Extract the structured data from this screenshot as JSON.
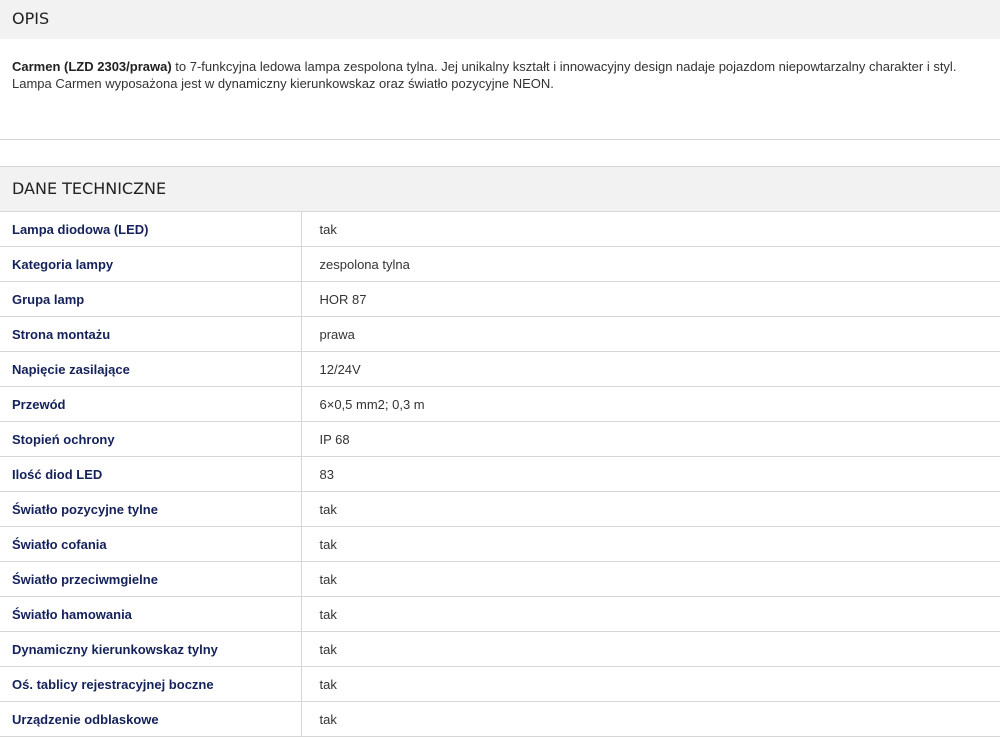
{
  "opis": {
    "title": "OPIS",
    "lead_bold": "Carmen (LZD 2303/prawa)",
    "text": " to 7-funkcyjna ledowa lampa zespolona tylna. Jej unikalny kształt i innowacyjny design nadaje pojazdom niepowtarzalny charakter i styl. Lampa Carmen wyposażona jest w dynamiczny kierunkowskaz oraz światło pozycyjne NEON."
  },
  "tech": {
    "title": "DANE TECHNICZNE",
    "rows": [
      {
        "label": "Lampa diodowa (LED)",
        "value": "tak"
      },
      {
        "label": "Kategoria lampy",
        "value": "zespolona tylna"
      },
      {
        "label": "Grupa lamp",
        "value": "HOR 87"
      },
      {
        "label": "Strona montażu",
        "value": "prawa"
      },
      {
        "label": "Napięcie zasilające",
        "value": "12/24V"
      },
      {
        "label": "Przewód",
        "value": "6×0,5 mm2; 0,3 m"
      },
      {
        "label": "Stopień ochrony",
        "value": "IP 68"
      },
      {
        "label": "Ilość diod LED",
        "value": "83"
      },
      {
        "label": "Światło pozycyjne tylne",
        "value": "tak"
      },
      {
        "label": "Światło cofania",
        "value": "tak"
      },
      {
        "label": "Światło przeciwmgielne",
        "value": "tak"
      },
      {
        "label": "Światło hamowania",
        "value": "tak"
      },
      {
        "label": "Dynamiczny kierunkowskaz tylny",
        "value": "tak"
      },
      {
        "label": "Oś. tablicy rejestracyjnej boczne",
        "value": "tak"
      },
      {
        "label": "Urządzenie odblaskowe",
        "value": "tak"
      }
    ]
  }
}
